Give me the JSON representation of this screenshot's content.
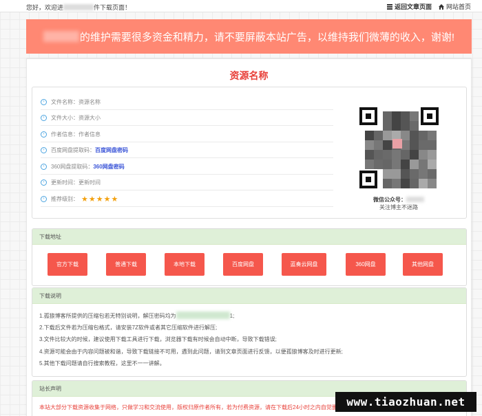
{
  "topbar": {
    "welcome_prefix": "您好，欢迎进",
    "welcome_suffix": "件下载页面！",
    "back_link": "返回文章页面",
    "home_link": "网站首页"
  },
  "ad_banner": {
    "text": "的维护需要很多资金和精力，请不要屏蔽本站广告，以维持我们微薄的收入，谢谢!"
  },
  "resource": {
    "title": "资源名称",
    "rows": [
      {
        "label": "文件名称：",
        "value": "资源名称"
      },
      {
        "label": "文件大小：",
        "value": "资源大小"
      },
      {
        "label": "作者信息：",
        "value": "作者信息"
      },
      {
        "label": "百度网盘提取码：",
        "value": "百度网盘密码"
      },
      {
        "label": "360网盘提取码：",
        "value": "360网盘密码"
      },
      {
        "label": "更新时间：",
        "value": "更新时间"
      },
      {
        "label": "推荐级别：",
        "value": "★★★★★"
      }
    ],
    "rating": 5,
    "qr_caption_line1": "微信公众号：",
    "qr_caption_line2": "关注博主不迷路"
  },
  "download": {
    "header": "下载地址",
    "buttons": [
      "官方下载",
      "普通下载",
      "本地下载",
      "百度网盘",
      "蓝奏云网盘",
      "360网盘",
      "其他网盘"
    ]
  },
  "instructions": {
    "header": "下载说明",
    "lines": [
      "1.孤狼博客所提供的压缩包若无特别说明，解压密码均为",
      "2.下载后文件若为压缩包格式，请安装7Z软件或者其它压缩软件进行解压;",
      "3.文件比较大的时候，建议使用下载工具进行下载，浏览器下载有时候会自动中断，导致下载错误;",
      "4.资源可能会由于内容问题被和谐，导致下载链接不可用，遇到此问题，请到文章页面进行反馈，以便孤狼博客及时进行更新;",
      "5.其他下载问题请自行搜索教程，这里不一一讲解。"
    ],
    "line1_tail": "1;"
  },
  "statement": {
    "header": "站长声明",
    "text": "本站大部分下载资源收集于网络，只做学习和交流使用，版权归原作者所有，若为付费资源，请在下载后24小时之内自觉删除，若作商业用途，请"
  },
  "watermark": "www.tiaozhuan.net",
  "colors": {
    "accent_red": "#e8413a",
    "button_red": "#f5574c",
    "banner_salmon": "#ff8873",
    "section_green": "#dff0d8",
    "link_blue": "#3c56d8",
    "star_orange": "#f3a10f"
  }
}
